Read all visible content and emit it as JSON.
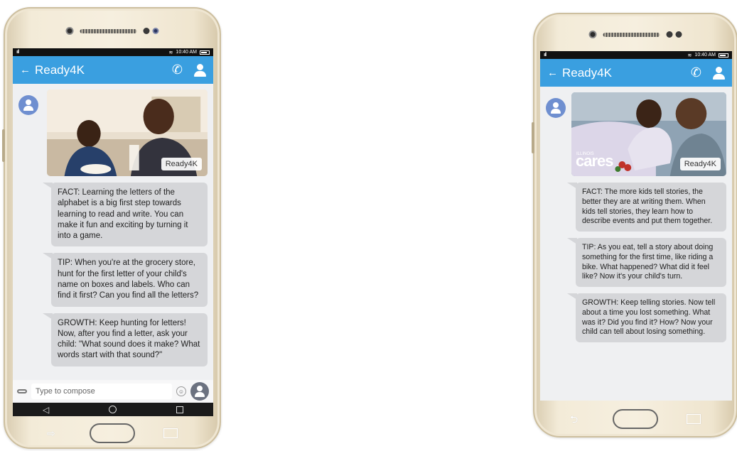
{
  "phones": [
    {
      "status": {
        "signal": "ııll",
        "wifi": "≋",
        "time": "10:40 AM"
      },
      "appbar": {
        "back": "←",
        "title": "Ready4K",
        "call": "✆"
      },
      "photo": {
        "logo": "Ready4K"
      },
      "messages": {
        "fact": "FACT: Learning the letters of the alphabet is a big first step towards learning to read and write. You can make it fun and exciting by turning it into a game.",
        "tip": "TIP: When you're at the grocery store, hunt for the first letter of your child's name on boxes and labels. Who can find it first? Can you find all the letters?",
        "growth": "GROWTH: Keep hunting for letters! Now, after you find a letter, ask your child: \"What sound does it make? What words start with that sound?\""
      },
      "compose": {
        "placeholder": "Type to compose",
        "smiley": "☺"
      },
      "nav": {
        "back": "◁"
      }
    },
    {
      "status": {
        "signal": "ııll",
        "wifi": "≋",
        "time": "10:40 AM"
      },
      "appbar": {
        "back": "←",
        "title": "Ready4K",
        "call": "✆"
      },
      "photo": {
        "logo": "Ready4K",
        "brand_small": "ILLINOIS",
        "brand": "cares"
      },
      "messages": {
        "fact": "FACT: The more kids tell stories, the better they are at writing them. When kids tell stories, they learn how to describe events and put them together.",
        "tip": "TIP: As you eat, tell a story about doing something for the first time, like riding a bike. What happened? What did it feel like? Now it's your child's turn.",
        "growth": "GROWTH: Keep telling stories. Now tell about a time you lost something. What was it? Did you find it? How? Now your child can tell about losing something."
      },
      "hardware": {
        "back": "⮌"
      }
    }
  ]
}
